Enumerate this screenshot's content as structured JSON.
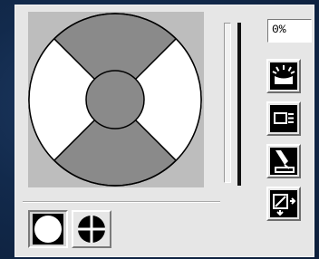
{
  "value_field": {
    "value": "0%"
  },
  "preview": {
    "shape": "circle",
    "background_color": "#bdbdbd",
    "dark_color": "#8a8a8a",
    "light_color": "#ffffff"
  },
  "shape_buttons": [
    {
      "name": "circle-shape-button",
      "icon": "white-circle-icon",
      "selected": true
    },
    {
      "name": "crosshair-shape-button",
      "icon": "crosshair-circle-icon",
      "selected": false
    }
  ],
  "tool_buttons": [
    {
      "name": "light-tool-button",
      "icon": "light-burst-icon"
    },
    {
      "name": "layout-tool-button",
      "icon": "panel-lines-icon"
    },
    {
      "name": "pencil-tool-button",
      "icon": "pencil-icon"
    },
    {
      "name": "resize-tool-button",
      "icon": "resize-arrows-icon"
    }
  ],
  "slider": {
    "level": 0
  }
}
